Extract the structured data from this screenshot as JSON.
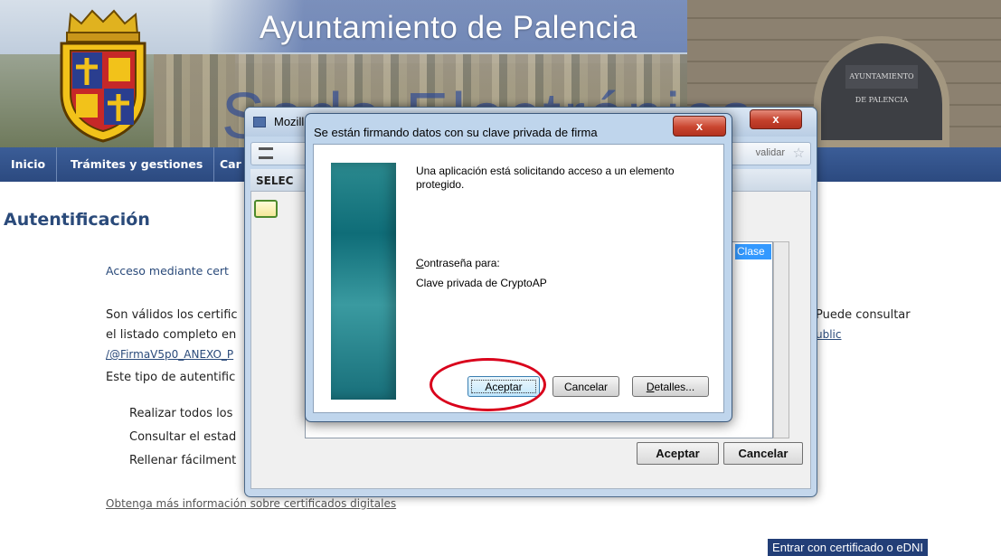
{
  "banner": {
    "site_title": "Ayuntamiento de Palencia",
    "sede_text": "Sede Electrónica",
    "plaque_text": "AYUNTAMIENTO DE PALENCIA"
  },
  "nav": {
    "items": [
      "Inicio",
      "Trámites y gestiones",
      "Car"
    ]
  },
  "content": {
    "heading": "Autentificación",
    "access_heading": "Acceso mediante cert",
    "para_line1_start": "Son válidos los certific",
    "para_line1_end": "Puede consultar",
    "para_line2_start": "el listado completo en",
    "para_line2_end": "ublic",
    "para_line3": "/@FirmaV5p0_ANEXO_P",
    "auth_type": "Este tipo de autentific",
    "bullets": [
      "Realizar todos los",
      "Consultar el estad",
      "Rellenar fácilment"
    ],
    "info_link": "Obtenga más información sobre certificados digitales",
    "enter_button": "Entrar con certificado o eDNI"
  },
  "mozilla_window": {
    "title": "Mozill",
    "url_tail": "validar",
    "select_label": "SELEC",
    "clase_cell": "Clase",
    "accept": "Aceptar",
    "cancel": "Cancelar",
    "close": "x"
  },
  "sign_dialog": {
    "title": "Se están firmando datos con su clave privada de firma",
    "close": "x",
    "message": "Una aplicación está solicitando acceso a un elemento protegido.",
    "password_label_first": "C",
    "password_label_rest": "ontraseña para:",
    "key_name": "Clave privada de CryptoAP",
    "accept": "Aceptar",
    "cancel": "Cancelar",
    "details_first": "D",
    "details_rest": "etalles..."
  },
  "colors": {
    "nav_blue": "#2c4a80",
    "heading_blue": "#2a4a7a",
    "enter_button": "#223e77",
    "annotation_red": "#d9001b"
  }
}
